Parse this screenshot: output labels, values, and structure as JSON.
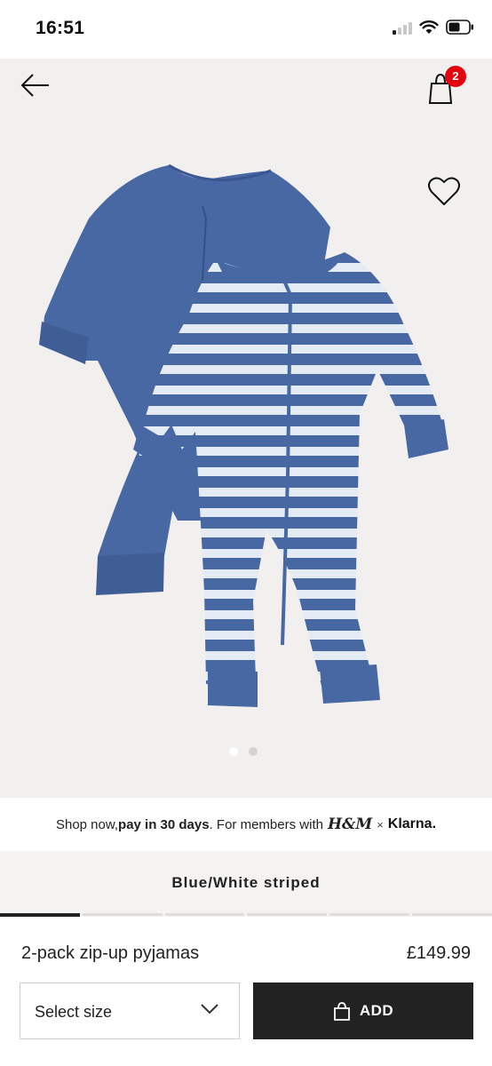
{
  "status_bar": {
    "time": "16:51"
  },
  "header": {
    "cart_count": "2"
  },
  "gallery": {
    "image_count": 2,
    "active_index": 0
  },
  "promo": {
    "prefix": "Shop now, ",
    "emphasis": "pay in 30 days",
    "suffix": ". For members with",
    "brand": "H&M",
    "separator": "×",
    "partner": "Klarna."
  },
  "color": {
    "name": "Blue/White striped",
    "swatch_count": 6,
    "active_swatch": 0
  },
  "product": {
    "name": "2-pack zip-up pyjamas",
    "price": "£149.99"
  },
  "actions": {
    "size_label": "Select size",
    "add_label": "ADD"
  },
  "colors": {
    "accent": "#e50010",
    "garment_blue": "#4868a3",
    "stripe_light": "#e4ebf5",
    "button_dark": "#222222",
    "hero_bg": "#f1f0ee"
  }
}
